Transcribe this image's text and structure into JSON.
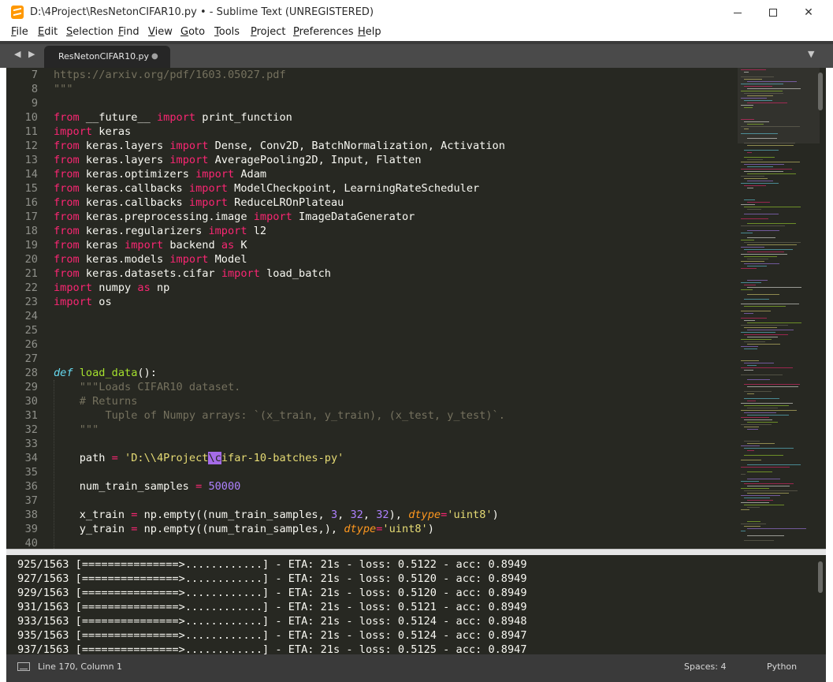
{
  "window": {
    "title": "D:\\4Project\\ResNetonCIFAR10.py • - Sublime Text (UNREGISTERED)",
    "minimize_icon": "minimize-icon",
    "maximize_icon": "maximize-icon",
    "close_icon": "close-icon",
    "close_glyph": "✕"
  },
  "menu": {
    "items": [
      "File",
      "Edit",
      "Selection",
      "Find",
      "View",
      "Goto",
      "Tools",
      "Project",
      "Preferences",
      "Help"
    ]
  },
  "tabs": {
    "nav_arrows": "◀ ▶",
    "active": {
      "label": "ResNetonCIFAR10.py",
      "dirty_indicator": "●"
    },
    "dropdown": "▼"
  },
  "editor": {
    "colors": {
      "background": "#272822",
      "keyword": "#f92672",
      "function": "#a6e22e",
      "string": "#e6db74",
      "number": "#ae81ff",
      "comment": "#75715e",
      "selection": "#a56be8"
    },
    "lines": [
      {
        "n": "7",
        "tokens": [
          {
            "t": "https://arxiv.org/pdf/1603.05027.pdf",
            "c": "cm"
          }
        ]
      },
      {
        "n": "8",
        "tokens": [
          {
            "t": "\"\"\"",
            "c": "cm"
          }
        ]
      },
      {
        "n": "9",
        "tokens": []
      },
      {
        "n": "10",
        "tokens": [
          {
            "t": "from",
            "c": "kw"
          },
          {
            "t": " __future__ "
          },
          {
            "t": "import",
            "c": "kw"
          },
          {
            "t": " print_function"
          }
        ]
      },
      {
        "n": "11",
        "tokens": [
          {
            "t": "import",
            "c": "kw"
          },
          {
            "t": " keras"
          }
        ]
      },
      {
        "n": "12",
        "tokens": [
          {
            "t": "from",
            "c": "kw"
          },
          {
            "t": " keras.layers "
          },
          {
            "t": "import",
            "c": "kw"
          },
          {
            "t": " Dense, Conv2D, BatchNormalization, Activation"
          }
        ]
      },
      {
        "n": "13",
        "tokens": [
          {
            "t": "from",
            "c": "kw"
          },
          {
            "t": " keras.layers "
          },
          {
            "t": "import",
            "c": "kw"
          },
          {
            "t": " AveragePooling2D, Input, Flatten"
          }
        ]
      },
      {
        "n": "14",
        "tokens": [
          {
            "t": "from",
            "c": "kw"
          },
          {
            "t": " keras.optimizers "
          },
          {
            "t": "import",
            "c": "kw"
          },
          {
            "t": " Adam"
          }
        ]
      },
      {
        "n": "15",
        "tokens": [
          {
            "t": "from",
            "c": "kw"
          },
          {
            "t": " keras.callbacks "
          },
          {
            "t": "import",
            "c": "kw"
          },
          {
            "t": " ModelCheckpoint, LearningRateScheduler"
          }
        ]
      },
      {
        "n": "16",
        "tokens": [
          {
            "t": "from",
            "c": "kw"
          },
          {
            "t": " keras.callbacks "
          },
          {
            "t": "import",
            "c": "kw"
          },
          {
            "t": " ReduceLROnPlateau"
          }
        ]
      },
      {
        "n": "17",
        "tokens": [
          {
            "t": "from",
            "c": "kw"
          },
          {
            "t": " keras.preprocessing.image "
          },
          {
            "t": "import",
            "c": "kw"
          },
          {
            "t": " ImageDataGenerator"
          }
        ]
      },
      {
        "n": "18",
        "tokens": [
          {
            "t": "from",
            "c": "kw"
          },
          {
            "t": " keras.regularizers "
          },
          {
            "t": "import",
            "c": "kw"
          },
          {
            "t": " l2"
          }
        ]
      },
      {
        "n": "19",
        "tokens": [
          {
            "t": "from",
            "c": "kw"
          },
          {
            "t": " keras "
          },
          {
            "t": "import",
            "c": "kw"
          },
          {
            "t": " backend "
          },
          {
            "t": "as",
            "c": "kw"
          },
          {
            "t": " K"
          }
        ]
      },
      {
        "n": "20",
        "tokens": [
          {
            "t": "from",
            "c": "kw"
          },
          {
            "t": " keras.models "
          },
          {
            "t": "import",
            "c": "kw"
          },
          {
            "t": " Model"
          }
        ]
      },
      {
        "n": "21",
        "tokens": [
          {
            "t": "from",
            "c": "kw"
          },
          {
            "t": " keras.datasets.cifar "
          },
          {
            "t": "import",
            "c": "kw"
          },
          {
            "t": " load_batch"
          }
        ]
      },
      {
        "n": "22",
        "tokens": [
          {
            "t": "import",
            "c": "kw"
          },
          {
            "t": " numpy "
          },
          {
            "t": "as",
            "c": "kw"
          },
          {
            "t": " np"
          }
        ]
      },
      {
        "n": "23",
        "tokens": [
          {
            "t": "import",
            "c": "kw"
          },
          {
            "t": " os"
          }
        ]
      },
      {
        "n": "24",
        "tokens": []
      },
      {
        "n": "25",
        "tokens": []
      },
      {
        "n": "26",
        "tokens": []
      },
      {
        "n": "27",
        "tokens": []
      },
      {
        "n": "28",
        "tokens": [
          {
            "t": "def",
            "c": "df"
          },
          {
            "t": " "
          },
          {
            "t": "load_data",
            "c": "fn"
          },
          {
            "t": "():"
          }
        ]
      },
      {
        "n": "29",
        "tokens": [
          {
            "t": "    "
          },
          {
            "t": "\"\"\"Loads CIFAR10 dataset.",
            "c": "cm"
          }
        ]
      },
      {
        "n": "30",
        "tokens": [
          {
            "t": "    "
          },
          {
            "t": "# Returns",
            "c": "cm"
          }
        ]
      },
      {
        "n": "31",
        "tokens": [
          {
            "t": "        "
          },
          {
            "t": "Tuple of Numpy arrays: `(x_train, y_train), (x_test, y_test)`.",
            "c": "cm"
          }
        ]
      },
      {
        "n": "32",
        "tokens": [
          {
            "t": "    "
          },
          {
            "t": "\"\"\"",
            "c": "cm"
          }
        ]
      },
      {
        "n": "33",
        "tokens": []
      },
      {
        "n": "34",
        "tokens": [
          {
            "t": "    path "
          },
          {
            "t": "=",
            "c": "kw"
          },
          {
            "t": " "
          },
          {
            "t": "'D:\\\\4Project",
            "c": "st"
          },
          {
            "t": "\\c",
            "c": "sel"
          },
          {
            "t": "ifar-10-batches-py'",
            "c": "st"
          }
        ]
      },
      {
        "n": "35",
        "tokens": []
      },
      {
        "n": "36",
        "tokens": [
          {
            "t": "    num_train_samples "
          },
          {
            "t": "=",
            "c": "kw"
          },
          {
            "t": " "
          },
          {
            "t": "50000",
            "c": "nm"
          }
        ]
      },
      {
        "n": "37",
        "tokens": []
      },
      {
        "n": "38",
        "tokens": [
          {
            "t": "    x_train "
          },
          {
            "t": "=",
            "c": "kw"
          },
          {
            "t": " np.empty((num_train_samples, "
          },
          {
            "t": "3",
            "c": "nm"
          },
          {
            "t": ", "
          },
          {
            "t": "32",
            "c": "nm"
          },
          {
            "t": ", "
          },
          {
            "t": "32",
            "c": "nm"
          },
          {
            "t": "), "
          },
          {
            "t": "dtype",
            "c": "pm"
          },
          {
            "t": "=",
            "c": "kw"
          },
          {
            "t": "'uint8'",
            "c": "st"
          },
          {
            "t": ")"
          }
        ]
      },
      {
        "n": "39",
        "tokens": [
          {
            "t": "    y_train "
          },
          {
            "t": "=",
            "c": "kw"
          },
          {
            "t": " np.empty((num_train_samples,), "
          },
          {
            "t": "dtype",
            "c": "pm"
          },
          {
            "t": "=",
            "c": "kw"
          },
          {
            "t": "'uint8'",
            "c": "st"
          },
          {
            "t": ")"
          }
        ]
      },
      {
        "n": "40",
        "tokens": []
      }
    ]
  },
  "console": {
    "lines": [
      "925/1563 [===============>............] - ETA: 21s - loss: 0.5122 - acc: 0.8949",
      "927/1563 [===============>............] - ETA: 21s - loss: 0.5120 - acc: 0.8949",
      "929/1563 [===============>............] - ETA: 21s - loss: 0.5120 - acc: 0.8949",
      "931/1563 [===============>............] - ETA: 21s - loss: 0.5121 - acc: 0.8949",
      "933/1563 [===============>............] - ETA: 21s - loss: 0.5124 - acc: 0.8948",
      "935/1563 [===============>............] - ETA: 21s - loss: 0.5124 - acc: 0.8947",
      "937/1563 [===============>............] - ETA: 21s - loss: 0.5125 - acc: 0.8947"
    ]
  },
  "status": {
    "panel_icon": "panel-toggle-icon",
    "position": "Line 170, Column 1",
    "spaces": "Spaces: 4",
    "syntax": "Python"
  }
}
